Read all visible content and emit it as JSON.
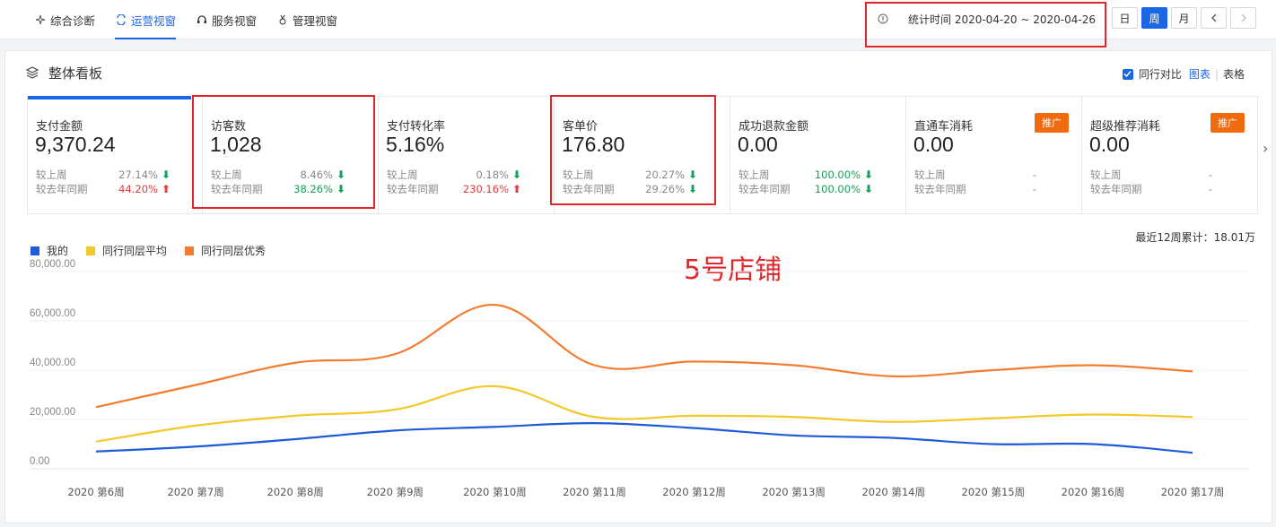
{
  "nav": {
    "items": [
      {
        "label": "综合诊断",
        "icon": "diagnosis-icon",
        "active": false
      },
      {
        "label": "运营视窗",
        "icon": "operation-icon",
        "active": true
      },
      {
        "label": "服务视窗",
        "icon": "headset-icon",
        "active": false
      },
      {
        "label": "管理视窗",
        "icon": "manage-icon",
        "active": false
      }
    ]
  },
  "stats_period": "统计时间 2020-04-20 ~ 2020-04-26",
  "period_buttons": {
    "day": "日",
    "week": "周",
    "month": "月",
    "active": "周"
  },
  "panel": {
    "title": "整体看板",
    "compare_label": "同行对比",
    "chart_link": "图表",
    "table_link": "表格"
  },
  "metrics": [
    {
      "title": "支付金额",
      "value": "9,370.24",
      "row1_label": "较上周",
      "row1_value": "27.14%",
      "row1_dir": "down",
      "row2_label": "较去年同期",
      "row2_value": "44.20%",
      "row2_dir": "up"
    },
    {
      "title": "访客数",
      "value": "1,028",
      "row1_label": "较上周",
      "row1_value": "8.46%",
      "row1_dir": "down",
      "row2_label": "较去年同期",
      "row2_value": "38.26%",
      "row2_dir": "down"
    },
    {
      "title": "支付转化率",
      "value": "5.16%",
      "row1_label": "较上周",
      "row1_value": "0.18%",
      "row1_dir": "down",
      "row2_label": "较去年同期",
      "row2_value": "230.16%",
      "row2_dir": "up"
    },
    {
      "title": "客单价",
      "value": "176.80",
      "row1_label": "较上周",
      "row1_value": "20.27%",
      "row1_dir": "down",
      "row2_label": "较去年同期",
      "row2_value": "29.26%",
      "row2_dir": "down"
    },
    {
      "title": "成功退款金额",
      "value": "0.00",
      "row1_label": "较上周",
      "row1_value": "100.00%",
      "row1_dir": "down",
      "row2_label": "较去年同期",
      "row2_value": "100.00%",
      "row2_dir": "down"
    },
    {
      "title": "直通车消耗",
      "value": "0.00",
      "row1_label": "较上周",
      "row1_value": "-",
      "row1_dir": "none",
      "row2_label": "较去年同期",
      "row2_value": "-",
      "row2_dir": "none",
      "promo": "推广"
    },
    {
      "title": "超级推荐消耗",
      "value": "0.00",
      "row1_label": "较上周",
      "row1_value": "-",
      "row1_dir": "none",
      "row2_label": "较去年同期",
      "row2_value": "-",
      "row2_dir": "none",
      "promo": "推广"
    }
  ],
  "accumulated": "最近12周累计：18.01万",
  "store_label": "5号店铺",
  "colors": {
    "accent": "#1a67e6",
    "mine": "#1f5bd8",
    "peer_avg": "#f2c928",
    "peer_top": "#f47c30",
    "highlight": "#e0262b",
    "promo": "#f06a0f"
  },
  "chart_data": {
    "type": "line",
    "categories": [
      "2020 第6周",
      "2020 第7周",
      "2020 第8周",
      "2020 第9周",
      "2020 第10周",
      "2020 第11周",
      "2020 第12周",
      "2020 第13周",
      "2020 第14周",
      "2020 第15周",
      "2020 第16周",
      "2020 第17周"
    ],
    "yticks": [
      "0.00",
      "20,000.00",
      "40,000.00",
      "60,000.00",
      "80,000.00"
    ],
    "ylim": [
      0,
      80000
    ],
    "series": [
      {
        "name": "我的",
        "color": "#1f5bd8",
        "values": [
          7000,
          9000,
          12000,
          15500,
          17000,
          18500,
          16500,
          13500,
          12500,
          10000,
          10000,
          6500
        ]
      },
      {
        "name": "同行同层平均",
        "color": "#f2c928",
        "values": [
          11000,
          17500,
          21500,
          24000,
          33500,
          21000,
          21500,
          21000,
          19000,
          20500,
          22000,
          21000
        ]
      },
      {
        "name": "同行同层优秀",
        "color": "#f47c30",
        "values": [
          25000,
          34000,
          43000,
          46500,
          66500,
          42000,
          43500,
          42000,
          37500,
          40000,
          42000,
          39500
        ]
      }
    ],
    "legend_position": "top-left",
    "grid": true
  }
}
